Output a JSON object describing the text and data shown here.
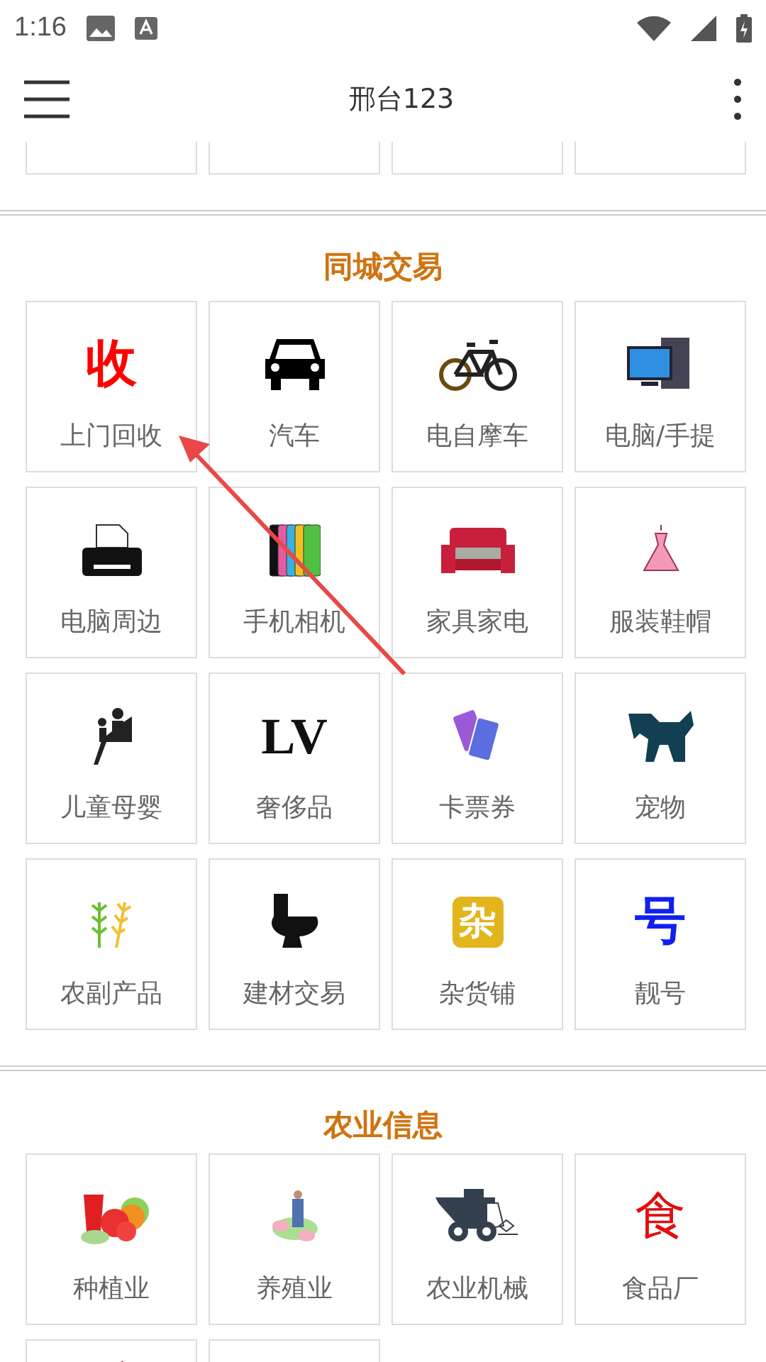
{
  "status_bar": {
    "time": "1:16"
  },
  "app_bar": {
    "title": "邢台123"
  },
  "sections": [
    {
      "title": "同城交易",
      "items": [
        {
          "label": "上门回收",
          "kind": "glyph",
          "glyph": "收"
        },
        {
          "label": "汽车",
          "kind": "icon"
        },
        {
          "label": "电自摩车",
          "kind": "icon"
        },
        {
          "label": "电脑/手提",
          "kind": "icon"
        },
        {
          "label": "电脑周边",
          "kind": "icon"
        },
        {
          "label": "手机相机",
          "kind": "icon"
        },
        {
          "label": "家具家电",
          "kind": "icon"
        },
        {
          "label": "服装鞋帽",
          "kind": "icon"
        },
        {
          "label": "儿童母婴",
          "kind": "icon"
        },
        {
          "label": "奢侈品",
          "kind": "glyph",
          "glyph": "LV"
        },
        {
          "label": "卡票券",
          "kind": "icon"
        },
        {
          "label": "宠物",
          "kind": "icon"
        },
        {
          "label": "农副产品",
          "kind": "icon"
        },
        {
          "label": "建材交易",
          "kind": "icon"
        },
        {
          "label": "杂货铺",
          "kind": "glyph",
          "glyph": "杂"
        },
        {
          "label": "靓号",
          "kind": "glyph",
          "glyph": "号"
        }
      ]
    },
    {
      "title": "农业信息",
      "items": [
        {
          "label": "种植业",
          "kind": "icon"
        },
        {
          "label": "养殖业",
          "kind": "icon"
        },
        {
          "label": "农业机械",
          "kind": "icon"
        },
        {
          "label": "食品厂",
          "kind": "glyph",
          "glyph": "食"
        },
        {
          "kind": "partial"
        },
        {
          "kind": "partial"
        }
      ]
    }
  ]
}
